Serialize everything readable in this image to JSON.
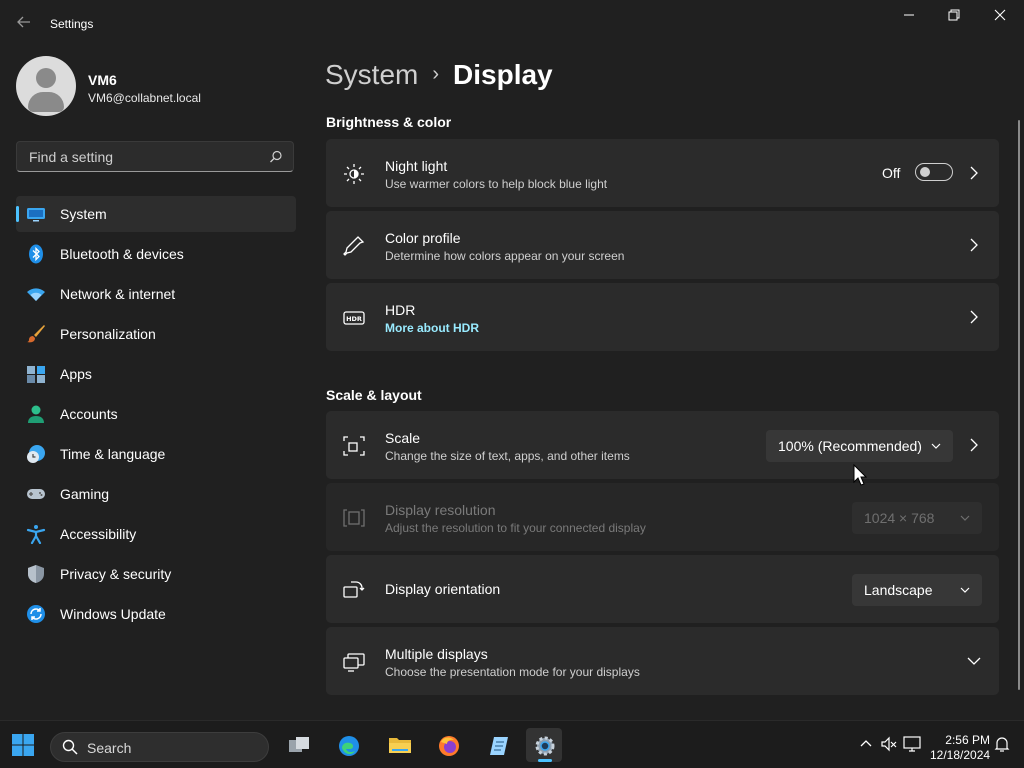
{
  "window": {
    "title": "Settings",
    "controls": {
      "minimize": "—",
      "maximize": "❐",
      "close": "✕"
    }
  },
  "profile": {
    "name": "VM6",
    "email": "VM6@collabnet.local"
  },
  "search": {
    "placeholder": "Find a setting"
  },
  "nav": {
    "items": [
      {
        "label": "System",
        "icon": "system-icon",
        "active": true
      },
      {
        "label": "Bluetooth & devices",
        "icon": "bluetooth-icon"
      },
      {
        "label": "Network & internet",
        "icon": "network-icon"
      },
      {
        "label": "Personalization",
        "icon": "brush-icon"
      },
      {
        "label": "Apps",
        "icon": "apps-icon"
      },
      {
        "label": "Accounts",
        "icon": "accounts-icon"
      },
      {
        "label": "Time & language",
        "icon": "time-language-icon"
      },
      {
        "label": "Gaming",
        "icon": "gamepad-icon"
      },
      {
        "label": "Accessibility",
        "icon": "accessibility-icon"
      },
      {
        "label": "Privacy & security",
        "icon": "shield-icon"
      },
      {
        "label": "Windows Update",
        "icon": "update-icon"
      }
    ]
  },
  "breadcrumb": {
    "parent": "System",
    "current": "Display"
  },
  "sections": {
    "brightness": "Brightness & color",
    "scale": "Scale & layout"
  },
  "cards": {
    "night_light": {
      "title": "Night light",
      "subtitle": "Use warmer colors to help block blue light",
      "toggle_label": "Off",
      "toggle_on": false
    },
    "color_profile": {
      "title": "Color profile",
      "subtitle": "Determine how colors appear on your screen"
    },
    "hdr": {
      "title": "HDR",
      "link": "More about HDR"
    },
    "scale": {
      "title": "Scale",
      "subtitle": "Change the size of text, apps, and other items",
      "value": "100% (Recommended)"
    },
    "resolution": {
      "title": "Display resolution",
      "subtitle": "Adjust the resolution to fit your connected display",
      "value": "1024 × 768",
      "disabled": true
    },
    "orientation": {
      "title": "Display orientation",
      "value": "Landscape"
    },
    "multiple": {
      "title": "Multiple displays",
      "subtitle": "Choose the presentation mode for your displays"
    }
  },
  "taskbar": {
    "search_label": "Search",
    "apps": [
      "task-view-icon",
      "edge-icon",
      "file-explorer-icon",
      "firefox-icon",
      "notepad-icon",
      "settings-icon"
    ],
    "clock": {
      "time": "2:56 PM",
      "date": "12/18/2024"
    }
  },
  "colors": {
    "accent": "#4cc2ff",
    "link": "#99ebff",
    "background": "#202020",
    "card": "#2b2b2b"
  }
}
